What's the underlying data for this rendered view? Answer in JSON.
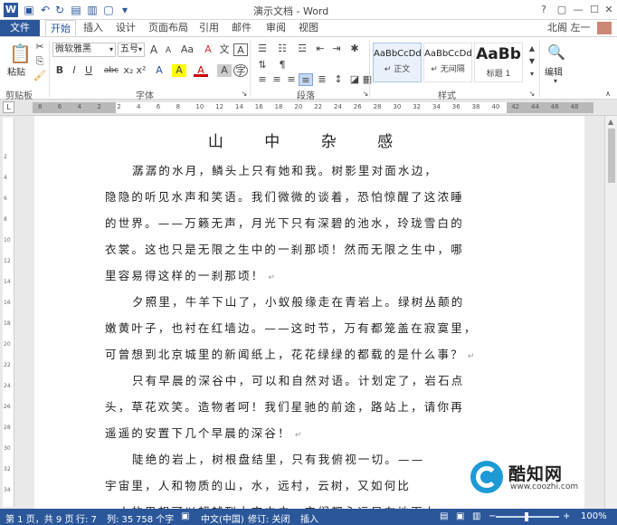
{
  "window": {
    "title": "演示文档 - Word",
    "app_icon": "W",
    "help": "?",
    "minimize": "—",
    "maximize": "☐",
    "close": "✕"
  },
  "tabs": [
    {
      "label": "文件"
    },
    {
      "label": "开始"
    },
    {
      "label": "插入"
    },
    {
      "label": "设计"
    },
    {
      "label": "页面布局"
    },
    {
      "label": "引用"
    },
    {
      "label": "邮件"
    },
    {
      "label": "审阅"
    },
    {
      "label": "视图"
    }
  ],
  "user": {
    "name": "北阁 左一"
  },
  "ribbon": {
    "clipboard": {
      "label": "剪贴板",
      "paste": "粘贴"
    },
    "font": {
      "label": "字体",
      "font_name": "微软雅黑",
      "font_size": "五号",
      "bold": "B",
      "italic": "I",
      "underline": "U",
      "strike": "abc",
      "subscript": "x₂",
      "superscript": "x²",
      "grow": "A",
      "shrink": "A",
      "case": "Aa",
      "clear": "A",
      "pinyin": "文",
      "border": "A",
      "color": "A",
      "highlight": "A",
      "shade": "A"
    },
    "paragraph": {
      "label": "段落"
    },
    "styles": {
      "label": "样式",
      "items": [
        {
          "sample": "AaBbCcDd",
          "name": "↵ 正文"
        },
        {
          "sample": "AaBbCcDd",
          "name": "↵ 无间隔"
        },
        {
          "sample": "AaBb",
          "name": "标题 1"
        }
      ]
    },
    "editing": {
      "label": "编辑"
    }
  },
  "ruler": {
    "corner": "L",
    "ticks": [
      "8",
      "6",
      "4",
      "2",
      "2",
      "4",
      "6",
      "8",
      "10",
      "12",
      "14",
      "16",
      "18",
      "20",
      "22",
      "24",
      "26",
      "28",
      "30",
      "32",
      "34",
      "36",
      "38",
      "40",
      "42",
      "44",
      "46",
      "48"
    ],
    "vticks": [
      "2",
      "4",
      "6",
      "8",
      "10",
      "12",
      "14",
      "16",
      "18",
      "20",
      "22",
      "24",
      "26",
      "28",
      "30",
      "32",
      "34"
    ]
  },
  "document": {
    "title": "山 中 杂 感",
    "lines": [
      "潺潺的水月，鳞头上只有她和我。树影里对面水边，",
      "隐隐的听见水声和笑语。我们微微的谈着，恐怕惊醒了这浓睡",
      "的世界。——万籁无声，月光下只有深碧的池水，玲珑雪白的",
      "衣裳。这也只是无限之生中的一刹那顷！然而无限之生中，哪",
      "里容易得这样的一刹那顷！",
      "夕照里，牛羊下山了，小蚁般缘走在青岩上。绿树丛颠的",
      "嫩黄叶子，也衬在红墙边。——这时节，万有都笼盖在寂寞里，",
      "可曾想到北京城里的新闻纸上，花花绿绿的都载的是什么事？",
      "只有早晨的深谷中，可以和自然对语。计划定了，岩石点",
      "头，草花欢笑。造物者呵！我们星驰的前途，路站上，请你再",
      "遥遥的安置下几个早晨的深谷！",
      "陡绝的岩上，树根盘结里，只有我俯视一切。——",
      "宇宙里，人和物质的山，水，远村，云树，又如何比",
      "一人的思想可以超越到太空中去，它们都永远只在地面上"
    ]
  },
  "status": {
    "page": "第 1 页，共 9 页",
    "row": "行: 7",
    "col": "列: 35",
    "words": "758 个字",
    "language": "中文(中国)",
    "track": "修订: 关闭",
    "mode": "插入",
    "zoom": "100%",
    "zoom_out": "−",
    "zoom_in": "+"
  },
  "watermark": {
    "brand": "酷知网",
    "site": "www.coozhi.com"
  }
}
